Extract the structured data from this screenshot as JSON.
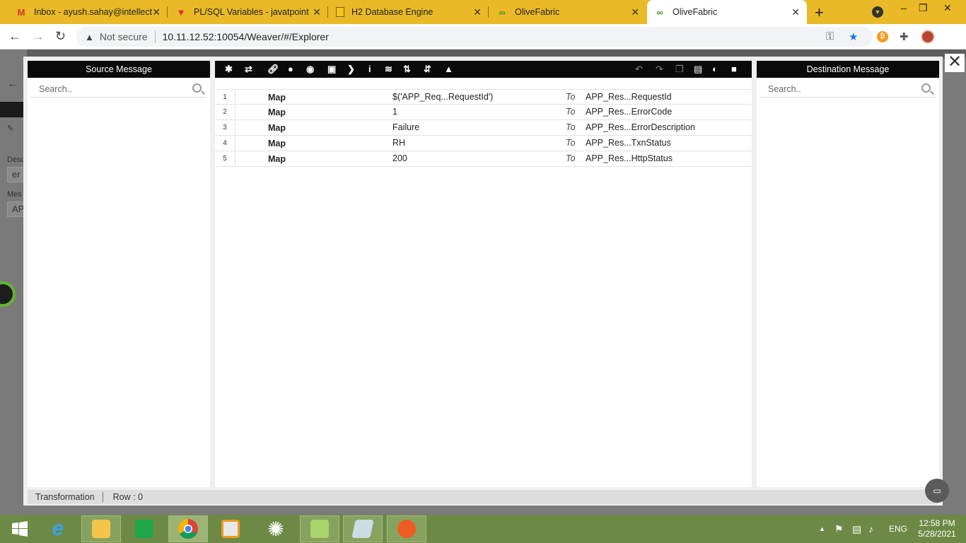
{
  "browser": {
    "tabs": [
      {
        "title": "Inbox - ayush.sahay@intellect",
        "icon": "gmail-icon",
        "color": "#d93025"
      },
      {
        "title": "PL/SQL Variables - javatpoint",
        "icon": "javatpoint-icon",
        "color": "#e02a2a"
      },
      {
        "title": "H2 Database Engine",
        "icon": "h2-icon",
        "color": "#f5c518"
      },
      {
        "title": "OliveFabric",
        "icon": "olivefabric-icon",
        "color": "#63b52f"
      },
      {
        "title": "OliveFabric",
        "icon": "olivefabric-icon",
        "color": "#63b52f"
      }
    ],
    "security_label": "Not secure",
    "url": "10.11.12.52:10054/Weaver/#/Explorer"
  },
  "modal": {
    "source_panel": {
      "title": "Source Message",
      "search_placeholder": "Search.."
    },
    "destination_panel": {
      "title": "Destination Message",
      "search_placeholder": "Search.."
    },
    "toolbar_left_icons": [
      "asterisk-icon",
      "retweet-icon",
      "link-icon",
      "map-marker-icon",
      "record-icon",
      "stop-icon",
      "play-icon",
      "info-icon",
      "stack-icon",
      "sort-up-icon",
      "sort-down-icon",
      "warning-icon"
    ],
    "toolbar_right_icons": [
      "undo-icon",
      "redo-icon",
      "copy-icon",
      "clipboard-icon",
      "contrast-icon",
      "save-icon"
    ],
    "rows": [
      {
        "num": "1",
        "op": "Map",
        "source": "$('APP_Req...RequestId')",
        "to": "To",
        "destination": "APP_Res...RequestId"
      },
      {
        "num": "2",
        "op": "Map",
        "source": "1",
        "to": "To",
        "destination": "APP_Res...ErrorCode"
      },
      {
        "num": "3",
        "op": "Map",
        "source": "Failure",
        "to": "To",
        "destination": "APP_Res...ErrorDescription"
      },
      {
        "num": "4",
        "op": "Map",
        "source": "RH",
        "to": "To",
        "destination": "APP_Res...TxnStatus"
      },
      {
        "num": "5",
        "op": "Map",
        "source": "200",
        "to": "To",
        "destination": "APP_Res...HttpStatus"
      }
    ],
    "status": {
      "mode": "Transformation",
      "row": "Row : 0"
    }
  },
  "taskbar": {
    "language": "ENG",
    "time": "12:58 PM",
    "date": "5/28/2021"
  }
}
